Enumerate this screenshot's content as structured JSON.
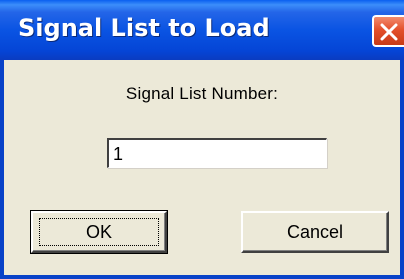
{
  "window": {
    "title": "Signal List to Load"
  },
  "dialog": {
    "prompt_label": "Signal List Number:",
    "input_value": "1",
    "ok_label": "OK",
    "cancel_label": "Cancel"
  },
  "icons": {
    "close": "close-icon"
  },
  "colors": {
    "titlebar": "#0A54E3",
    "close_button": "#E4502B",
    "dialog_background": "#ECE9D8"
  }
}
